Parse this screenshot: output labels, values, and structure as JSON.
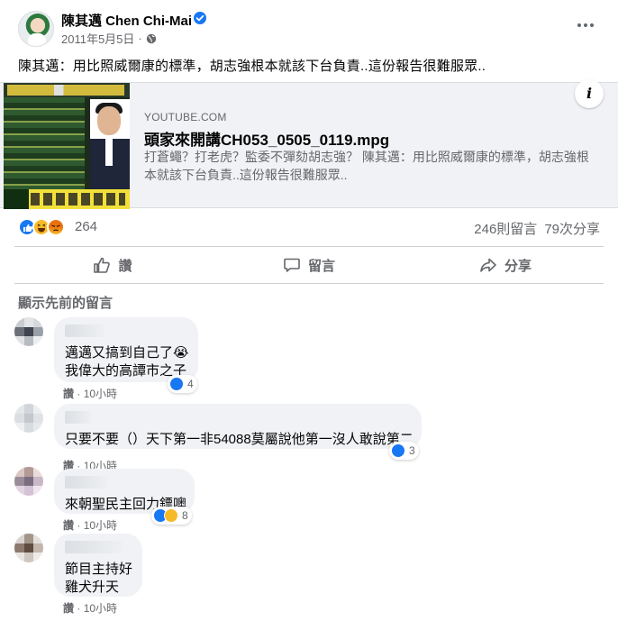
{
  "post": {
    "author": "陳其邁 Chen Chi-Mai",
    "date": "2011年5月5日",
    "separator": "·",
    "text": "陳其邁：用比照威爾康的標準，胡志強根本就該下台負責..這份報告很難服眾.."
  },
  "link": {
    "domain": "YOUTUBE.COM",
    "title": "頭家來開講CH053_0505_0119.mpg",
    "description": "打蒼蠅？打老虎？監委不彈劾胡志強？ 陳其邁：用比照威爾康的標準，胡志強根本就該下台負責..這份報告很難服眾..",
    "info_glyph": "i"
  },
  "reactions": {
    "icons": [
      "like-icon",
      "haha-icon",
      "angry-icon"
    ],
    "count": "264",
    "comments": "246則留言",
    "shares": "79次分享"
  },
  "actions": {
    "like": "讚",
    "comment": "留言",
    "share": "分享"
  },
  "comments_section": {
    "view_previous": "顯示先前的留言",
    "items": [
      {
        "lines": [
          "邁邁又搞到自己了😭",
          "我偉大的高譚市之子"
        ],
        "reaction_count": "4",
        "reaction_icons": [
          "like-icon"
        ],
        "like_label": "讚",
        "dot": "·",
        "time": "10小時"
      },
      {
        "lines": [
          "只要不要（）天下第一非54088莫屬說他第一沒人敢說第二"
        ],
        "reaction_count": "3",
        "reaction_icons": [
          "like-icon"
        ],
        "like_label": "讚",
        "dot": "·",
        "time": "10小時"
      },
      {
        "lines": [
          "來朝聖民主回力鏢噢"
        ],
        "reaction_count": "8",
        "reaction_icons": [
          "like-icon",
          "haha-icon"
        ],
        "like_label": "讚",
        "dot": "·",
        "time": "10小時"
      },
      {
        "lines": [
          "節目主持好",
          "雞犬升天"
        ],
        "reaction_count": "",
        "reaction_icons": [],
        "like_label": "讚",
        "dot": "·",
        "time": "10小時"
      }
    ]
  },
  "colors": {
    "facebook_blue": "#1877f2",
    "secondary_text": "#65676b",
    "bubble": "#f0f2f5",
    "haha_yellow": "#f7b928",
    "angry_orange": "#e9710f"
  }
}
